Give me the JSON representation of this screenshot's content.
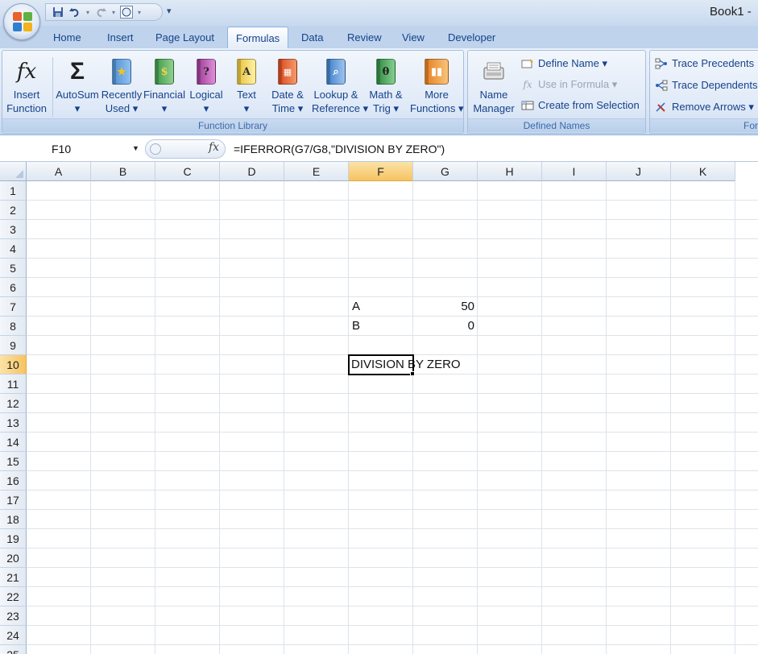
{
  "window": {
    "title": "Book1 - "
  },
  "qat": {
    "save_icon": "save-icon",
    "undo_icon": "undo-icon",
    "redo_icon": "redo-icon",
    "shape_icon": "circle-shape-icon"
  },
  "tabs": [
    {
      "label": "Home"
    },
    {
      "label": "Insert"
    },
    {
      "label": "Page Layout"
    },
    {
      "label": "Formulas",
      "active": true
    },
    {
      "label": "Data"
    },
    {
      "label": "Review"
    },
    {
      "label": "View"
    },
    {
      "label": "Developer"
    }
  ],
  "ribbon": {
    "function_library": {
      "label": "Function Library",
      "insert_function": {
        "line1": "Insert",
        "line2": "Function"
      },
      "autosum": {
        "line1": "AutoSum",
        "line2": "▾"
      },
      "recently_used": {
        "line1": "Recently",
        "line2": "Used ▾"
      },
      "financial": {
        "line1": "Financial",
        "line2": "▾"
      },
      "logical": {
        "line1": "Logical",
        "line2": "▾"
      },
      "text": {
        "line1": "Text",
        "line2": "▾"
      },
      "date_time": {
        "line1": "Date &",
        "line2": "Time ▾"
      },
      "lookup": {
        "line1": "Lookup &",
        "line2": "Reference ▾"
      },
      "math_trig": {
        "line1": "Math &",
        "line2": "Trig ▾"
      },
      "more_functions": {
        "line1": "More",
        "line2": "Functions ▾"
      }
    },
    "defined_names": {
      "label": "Defined Names",
      "name_manager": {
        "line1": "Name",
        "line2": "Manager"
      },
      "define_name": "Define Name ▾",
      "use_in_formula": "Use in Formula ▾",
      "create_from_selection": "Create from Selection"
    },
    "formula_auditing": {
      "label": "For",
      "trace_precedents": "Trace Precedents",
      "trace_dependents": "Trace Dependents",
      "remove_arrows": "Remove Arrows ▾"
    }
  },
  "formula_bar": {
    "name_box": "F10",
    "fx": "fx",
    "formula": "=IFERROR(G7/G8,\"DIVISION BY ZERO\")"
  },
  "sheet": {
    "columns": [
      "A",
      "B",
      "C",
      "D",
      "E",
      "F",
      "G",
      "H",
      "I",
      "J",
      "K"
    ],
    "rows": [
      "1",
      "2",
      "3",
      "4",
      "5",
      "6",
      "7",
      "8",
      "9",
      "10",
      "11",
      "12",
      "13",
      "14",
      "15",
      "16",
      "17",
      "18",
      "19",
      "20",
      "21",
      "22",
      "23",
      "24",
      "25"
    ],
    "selected_column": "F",
    "selected_row": "10",
    "cells": {
      "F7": "A",
      "G7": "50",
      "F8": "B",
      "G8": "0",
      "F10": "DIVISION BY ZERO"
    }
  }
}
